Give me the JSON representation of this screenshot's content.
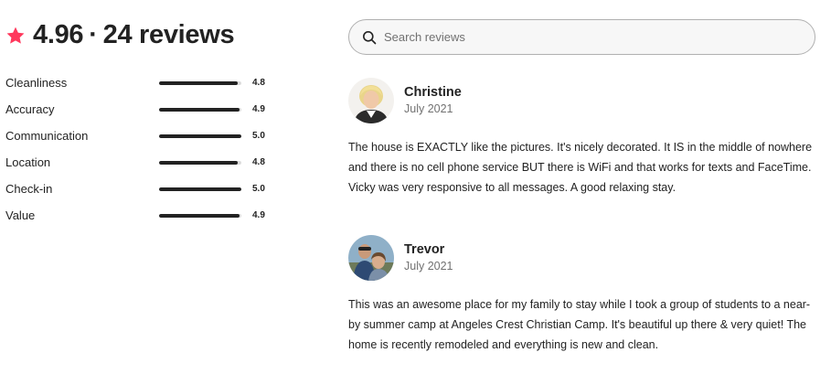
{
  "summary": {
    "rating": "4.96",
    "separator": "·",
    "reviews_count": "24 reviews",
    "star_icon": "star-icon",
    "star_color": "#FF385C"
  },
  "ratings": [
    {
      "label": "Cleanliness",
      "value": "4.8",
      "fraction": 0.96
    },
    {
      "label": "Accuracy",
      "value": "4.9",
      "fraction": 0.98
    },
    {
      "label": "Communication",
      "value": "5.0",
      "fraction": 1.0
    },
    {
      "label": "Location",
      "value": "4.8",
      "fraction": 0.96
    },
    {
      "label": "Check-in",
      "value": "5.0",
      "fraction": 1.0
    },
    {
      "label": "Value",
      "value": "4.9",
      "fraction": 0.98
    }
  ],
  "search": {
    "placeholder": "Search reviews",
    "value": "",
    "icon": "search-icon"
  },
  "reviews": [
    {
      "name": "Christine",
      "date": "July 2021",
      "text": "The house is EXACTLY like the pictures. It's nicely decorated. It IS in the middle of nowhere and there is no cell phone service BUT there is WiFi and that works for texts and FaceTime. Vicky was very responsive to all messages. A good relaxing stay."
    },
    {
      "name": "Trevor",
      "date": "July 2021",
      "text": "This was an awesome place for my family to stay while I took a group of students to a near-by summer camp at Angeles Crest Christian Camp. It's beautiful up there & very quiet! The home is recently remodeled and everything is new and clean."
    }
  ]
}
